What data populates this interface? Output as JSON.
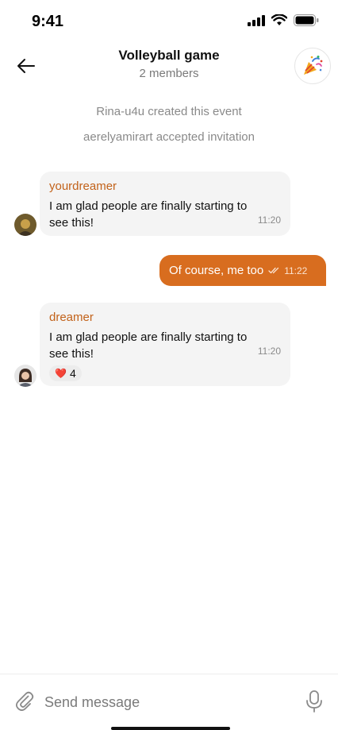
{
  "status_bar": {
    "time": "9:41"
  },
  "header": {
    "title": "Volleyball game",
    "subtitle": "2 members"
  },
  "system_messages": [
    "Rina-u4u created this event",
    "aerelyamirart accepted invitation"
  ],
  "messages": [
    {
      "sender": "yourdreamer",
      "text": "I am glad people are finally starting to see this!",
      "time": "11:20"
    },
    {
      "text": "Of course, me too",
      "time": "11:22"
    },
    {
      "sender": "dreamer",
      "text": "I am glad people are finally starting to see this!",
      "time": "11:20",
      "reaction": {
        "emoji": "❤️",
        "count": "4"
      }
    }
  ],
  "composer": {
    "placeholder": "Send message"
  },
  "colors": {
    "accent": "#d86d1f",
    "sender_name": "#c2621a",
    "bubble_in": "#f4f4f4"
  },
  "icons": [
    "signal-icon",
    "wifi-icon",
    "battery-icon",
    "back-arrow-icon",
    "party-popper-icon",
    "double-check-icon",
    "paperclip-icon",
    "microphone-icon"
  ]
}
